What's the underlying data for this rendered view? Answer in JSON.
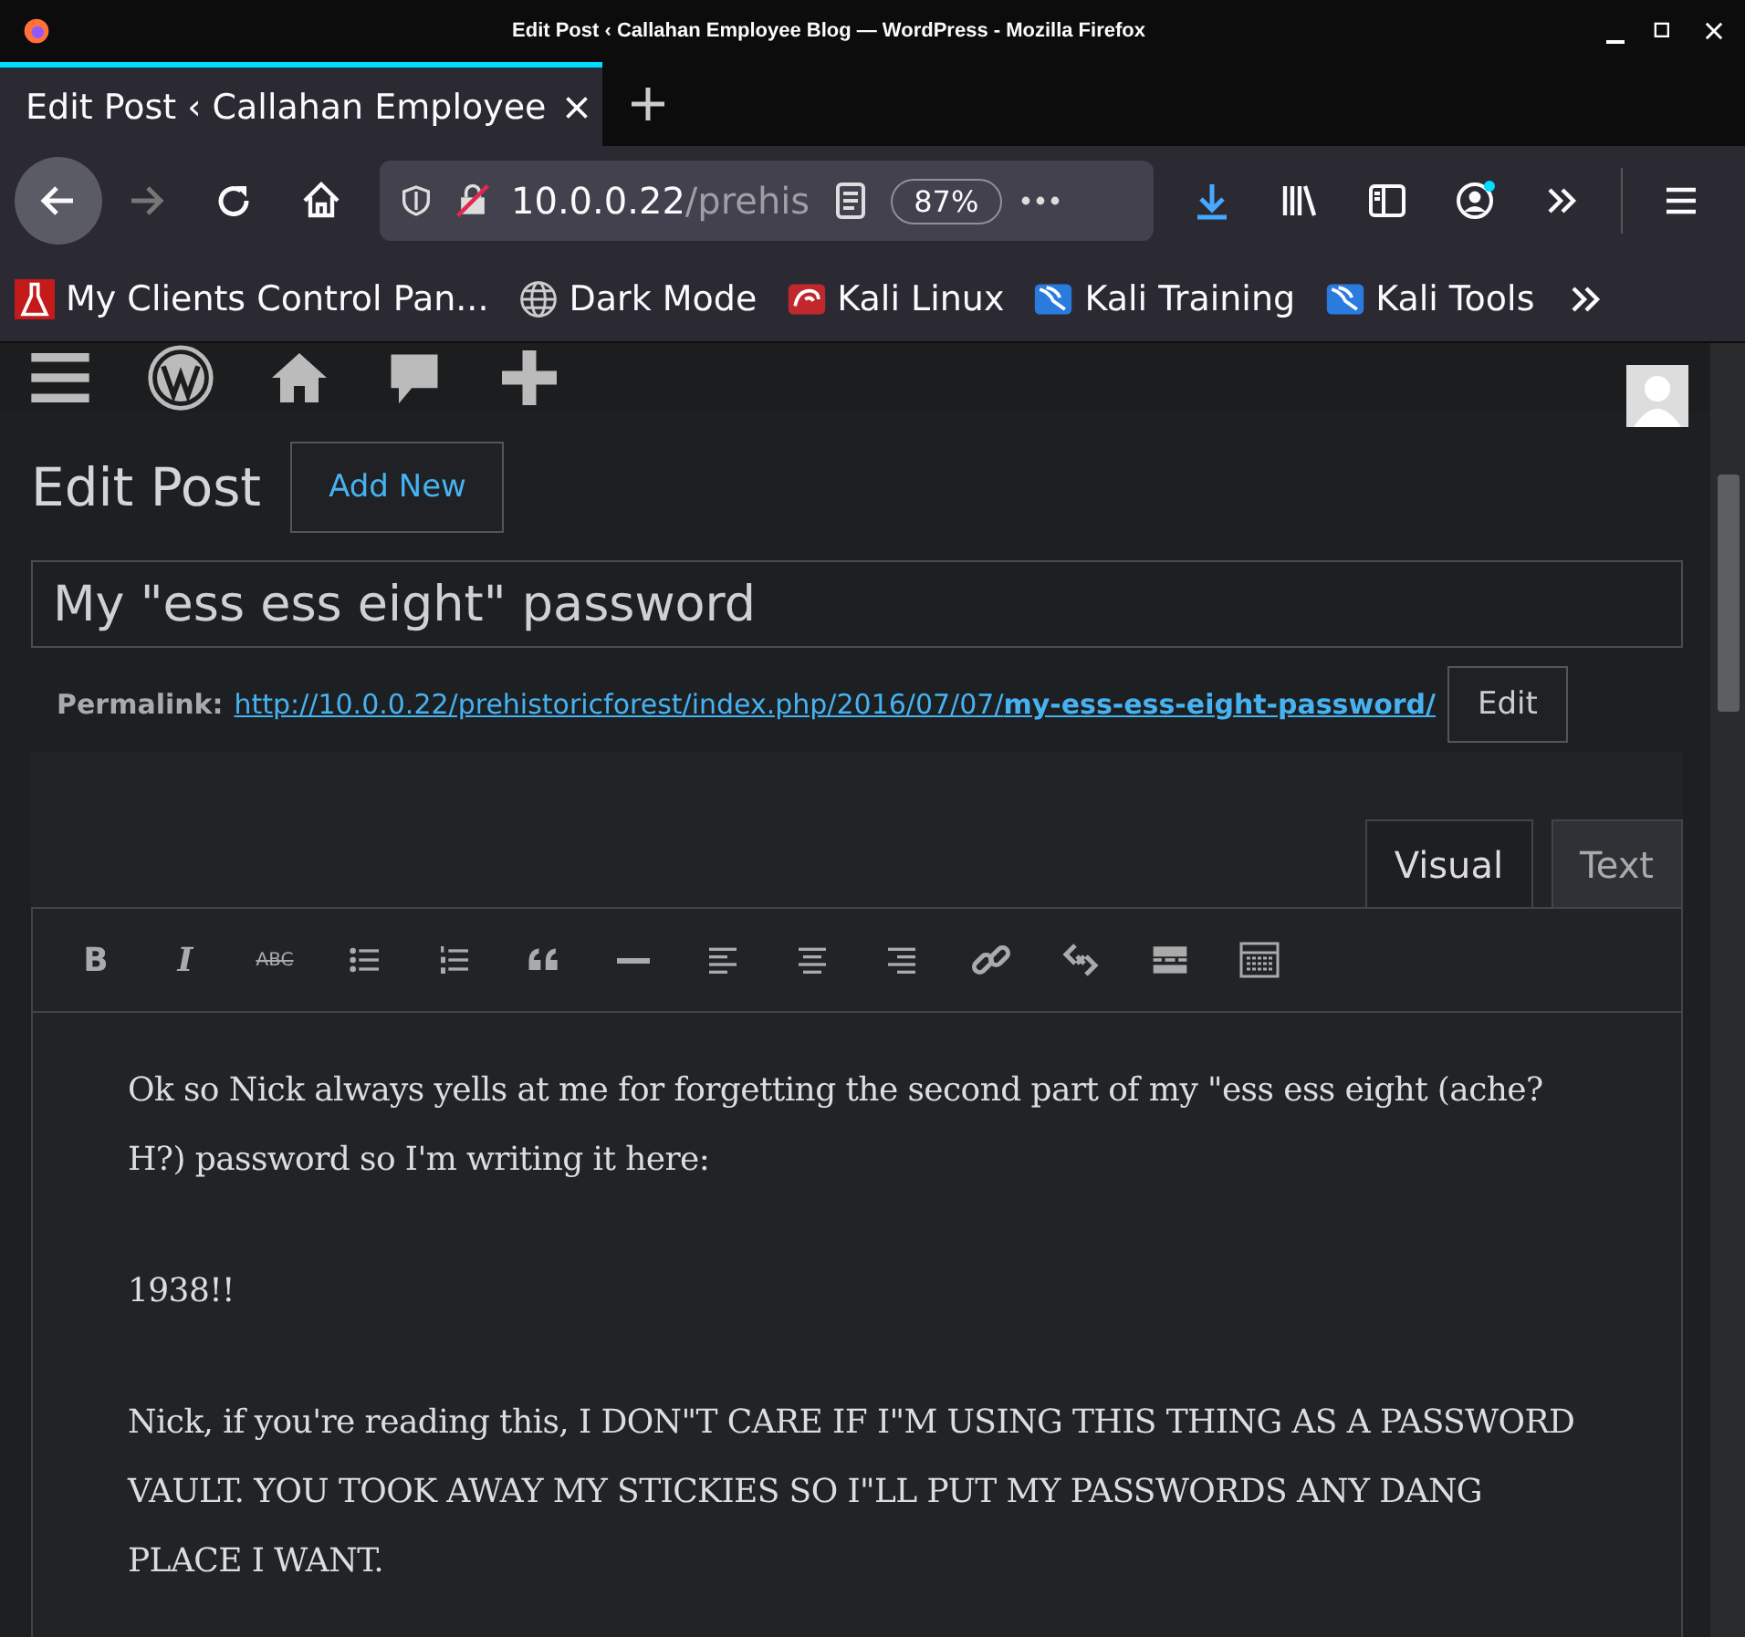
{
  "window": {
    "title": "Edit Post ‹ Callahan Employee Blog — WordPress - Mozilla Firefox"
  },
  "tabs": [
    {
      "label": "Edit Post ‹ Callahan Employee",
      "selected": true
    }
  ],
  "address_bar": {
    "host": "10.0.0.22",
    "path": "/prehis",
    "zoom": "87%"
  },
  "bookmarks": [
    {
      "kind": "app",
      "label": "My Clients Control Pan..."
    },
    {
      "kind": "globe",
      "label": "Dark Mode"
    },
    {
      "kind": "kali-red",
      "label": "Kali Linux"
    },
    {
      "kind": "kali-blue",
      "label": "Kali Training"
    },
    {
      "kind": "kali-blue",
      "label": "Kali Tools"
    }
  ],
  "page": {
    "heading": "Edit Post",
    "add_new": "Add New",
    "title_value": "My \"ess ess eight\" password",
    "permalink_label": "Permalink:",
    "permalink_base": "http://10.0.0.22/prehistoricforest/index.php/2016/07/07/",
    "permalink_slug": "my-ess-ess-eight-password/",
    "edit_button": "Edit"
  },
  "editor_tabs": [
    {
      "label": "Visual",
      "selected": true
    },
    {
      "label": "Text",
      "selected": false
    }
  ],
  "toolbar": [
    {
      "kind": "glyph",
      "glyph": "B"
    },
    {
      "kind": "glyph-italic",
      "glyph": "I"
    },
    {
      "kind": "glyph-strike",
      "glyph": "ABC"
    },
    {
      "kind": "bullet-list"
    },
    {
      "kind": "numbered-list"
    },
    {
      "kind": "quote"
    },
    {
      "kind": "rule"
    },
    {
      "kind": "align-left"
    },
    {
      "kind": "align-center"
    },
    {
      "kind": "align-right"
    },
    {
      "kind": "link"
    },
    {
      "kind": "unlink"
    },
    {
      "kind": "read-more"
    },
    {
      "kind": "toolbar-toggle"
    }
  ],
  "content": [
    "Ok so Nick always yells at me for forgetting the second part of my \"ess ess eight (ache? H?) password so I'm writing it here:",
    "1938!!",
    "Nick, if you're reading this, I DON\"T CARE IF I\"M USING THIS THING AS A PASSWORD VAULT. YOU TOOK AWAY MY STICKIES SO I\"LL PUT MY PASSWORDS ANY DANG PLACE I WANT."
  ]
}
